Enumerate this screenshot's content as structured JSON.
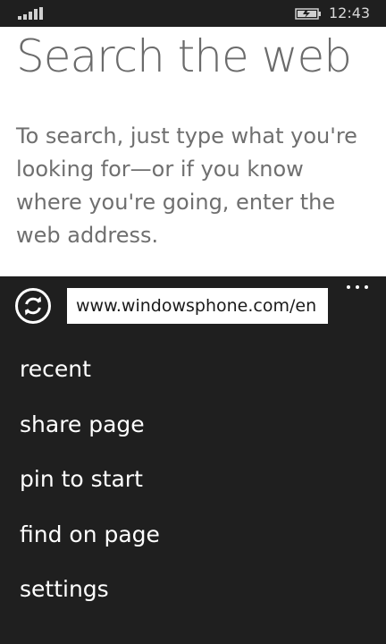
{
  "status_bar": {
    "time": "12:43",
    "signal_icon": "signal-strength-icon",
    "battery_icon": "battery-charging-icon"
  },
  "page": {
    "title": "Search the web",
    "description": "To search, just type what you're looking for—or if you know where you're going, enter the web address."
  },
  "app_bar": {
    "refresh_icon": "refresh-icon",
    "address_value": "www.windowsphone.com/en",
    "more_icon": "ellipsis-icon",
    "menu_items": [
      {
        "label": "recent"
      },
      {
        "label": "share page"
      },
      {
        "label": "pin to start"
      },
      {
        "label": "find on page"
      },
      {
        "label": "settings"
      }
    ]
  },
  "colors": {
    "content_background": "#ffffff",
    "app_bar_background": "#1f1f1f",
    "title_text": "#6b6b6b",
    "menu_text": "#ffffff"
  }
}
